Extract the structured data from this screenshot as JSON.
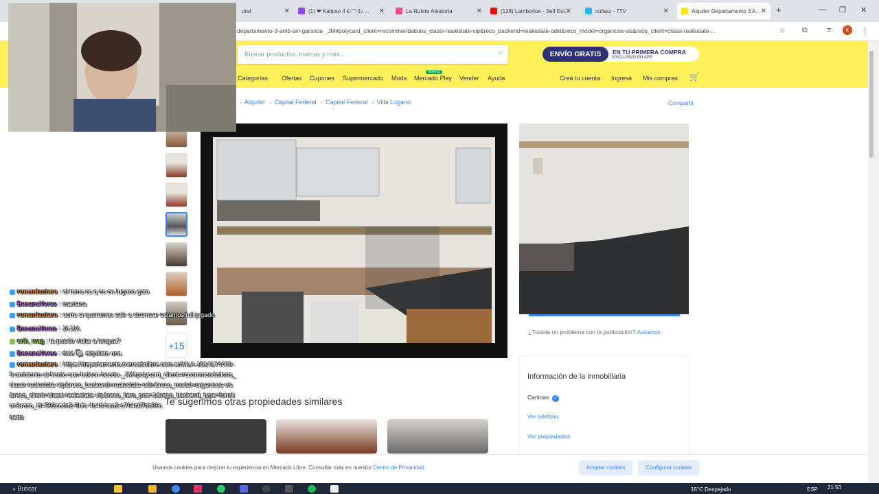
{
  "browser": {
    "tabs": [
      {
        "label": "und",
        "favicon_color": "#ffffff"
      },
      {
        "label": "(1) ❤ Kalipso 4 £-\"\"-3♪ ...",
        "favicon_color": "#9146ff"
      },
      {
        "label": "La Ruleta Aleatoria",
        "favicon_color": "#e94c89"
      },
      {
        "label": "(128) Lambo4oe - Self Est...",
        "favicon_color": "#ff0000"
      },
      {
        "label": "cufasz - 7TV",
        "favicon_color": "#29b6f6"
      },
      {
        "label": "Alquiler Departamento 3 A...",
        "favicon_color": "#ffe600"
      }
    ],
    "new_tab": "+",
    "url": "departamento-3-amb-sin-garantia-_JM#polycard_client=recommendations_classi-realestate-vip&reco_backend=realestate-odin&reco_model=organicos-vis&reco_client=classi-realestate-...",
    "profile_initial": "k"
  },
  "site": {
    "search_placeholder": "Buscar productos, marcas y más...",
    "promo_pill": "ENVÍO GRATIS",
    "promo_line1": "EN TU PRIMERA COMPRA",
    "promo_line2": "EXCLUSIVO EN APP",
    "nav": [
      "Categorías",
      "Ofertas",
      "Cupones",
      "Supermercado",
      "Moda",
      "Mercado Play",
      "Vender",
      "Ayuda"
    ],
    "new_badge": "GRATIS",
    "account": [
      "Creá tu cuenta",
      "Ingresá",
      "Mis compras"
    ],
    "breadcrumb": [
      "Alquiler",
      "Capital Federal",
      "Capital Federal",
      "Villa Lugano"
    ],
    "share": "Compartir",
    "more_photos": "+15",
    "report_text": "¿Tuviste un problema con la publicación?",
    "report_link": "Avisanos.",
    "info_title": "Información de la inmobiliaria",
    "agent_name": "Cariinas",
    "view_phone": "Ver teléfono",
    "view_properties": "Ver propiedades",
    "similar_title": "Te sugerimos otras propiedades similares",
    "cookie_text": "Usamos cookies para mejorar tu experiencia en Mercado Libre. Consultar más en nuestro",
    "cookie_link": "Centro de Privacidad",
    "accept_cookies": "Aceptar cookies",
    "config_cookies": "Configurar cookies"
  },
  "chat": [
    {
      "user": "romanlautaro",
      "user_color": "#e8891c",
      "text": ": el tema es q es en lugano gato"
    },
    {
      "user": "BananaVerse",
      "user_color": "#b05fd8",
      "text": ": maniana"
    },
    {
      "user": "romanlautaro",
      "user_color": "#e8891c",
      "text": ": corte si queremos salir a stremear estamos full jugado"
    },
    {
      "user": "BananaVerse",
      "user_color": "#b05fd8",
      "text": ": JAJJA"
    },
    {
      "user": "erik_wag",
      "user_color": "#9acd32",
      "text": ": te puedo violar a lengua?"
    },
    {
      "user": "BananaVerse",
      "user_color": "#b05fd8",
      "text": ": dale 🐘 alquilate una"
    },
    {
      "user": "romanlautaro",
      "user_color": "#e8891c",
      "text": ": https://departamento.mercadolibre.com.ar/MLA-1514174409-3-ambiente-al-frente-con-balcon-boedo-_JM#polycard_client=recommendations_classi-realestate-vip&reco_backend=realestate-odin&reco_model=organicos-vis&reco_client=classi-realestate-vip&reco_item_pos=1&reco_backend_type=function&reco_id=592ceda2-6bfc-4b4d-bca2-c764c07bb86c"
    },
    {
      "user": "",
      "user_color": "#ffffff",
      "text": "oedo"
    }
  ],
  "taskbar": {
    "search": "Buscar",
    "weather": "15°C  Despejado",
    "lang": "ESP",
    "time": "21:53"
  }
}
